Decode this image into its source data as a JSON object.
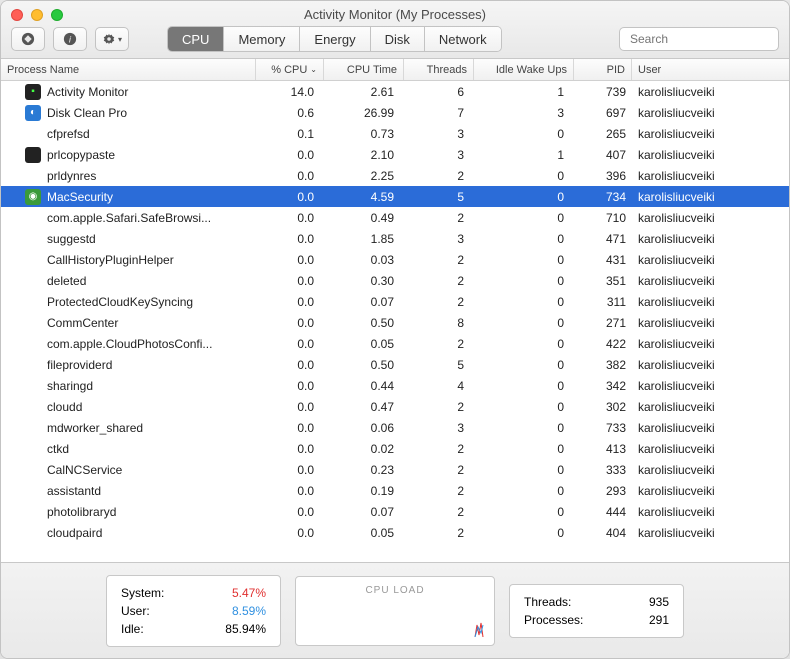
{
  "window_title": "Activity Monitor (My Processes)",
  "tabs": {
    "cpu": "CPU",
    "memory": "Memory",
    "energy": "Energy",
    "disk": "Disk",
    "network": "Network"
  },
  "search_placeholder": "Search",
  "columns": {
    "name": "Process Name",
    "cpu": "% CPU",
    "time": "CPU Time",
    "threads": "Threads",
    "wake": "Idle Wake Ups",
    "pid": "PID",
    "user": "User"
  },
  "processes": [
    {
      "name": "Activity Monitor",
      "cpu": "14.0",
      "time": "2.61",
      "threads": "6",
      "wake": "1",
      "pid": "739",
      "user": "karolisliucveiki",
      "icon": "am"
    },
    {
      "name": "Disk Clean Pro",
      "cpu": "0.6",
      "time": "26.99",
      "threads": "7",
      "wake": "3",
      "pid": "697",
      "user": "karolisliucveiki",
      "icon": "dc"
    },
    {
      "name": "cfprefsd",
      "cpu": "0.1",
      "time": "0.73",
      "threads": "3",
      "wake": "0",
      "pid": "265",
      "user": "karolisliucveiki"
    },
    {
      "name": "prlcopypaste",
      "cpu": "0.0",
      "time": "2.10",
      "threads": "3",
      "wake": "1",
      "pid": "407",
      "user": "karolisliucveiki",
      "icon": "term"
    },
    {
      "name": "prldynres",
      "cpu": "0.0",
      "time": "2.25",
      "threads": "2",
      "wake": "0",
      "pid": "396",
      "user": "karolisliucveiki"
    },
    {
      "name": "MacSecurity",
      "cpu": "0.0",
      "time": "4.59",
      "threads": "5",
      "wake": "0",
      "pid": "734",
      "user": "karolisliucveiki",
      "icon": "shield",
      "selected": true
    },
    {
      "name": "com.apple.Safari.SafeBrowsi...",
      "cpu": "0.0",
      "time": "0.49",
      "threads": "2",
      "wake": "0",
      "pid": "710",
      "user": "karolisliucveiki"
    },
    {
      "name": "suggestd",
      "cpu": "0.0",
      "time": "1.85",
      "threads": "3",
      "wake": "0",
      "pid": "471",
      "user": "karolisliucveiki"
    },
    {
      "name": "CallHistoryPluginHelper",
      "cpu": "0.0",
      "time": "0.03",
      "threads": "2",
      "wake": "0",
      "pid": "431",
      "user": "karolisliucveiki"
    },
    {
      "name": "deleted",
      "cpu": "0.0",
      "time": "0.30",
      "threads": "2",
      "wake": "0",
      "pid": "351",
      "user": "karolisliucveiki"
    },
    {
      "name": "ProtectedCloudKeySyncing",
      "cpu": "0.0",
      "time": "0.07",
      "threads": "2",
      "wake": "0",
      "pid": "311",
      "user": "karolisliucveiki"
    },
    {
      "name": "CommCenter",
      "cpu": "0.0",
      "time": "0.50",
      "threads": "8",
      "wake": "0",
      "pid": "271",
      "user": "karolisliucveiki"
    },
    {
      "name": "com.apple.CloudPhotosConfi...",
      "cpu": "0.0",
      "time": "0.05",
      "threads": "2",
      "wake": "0",
      "pid": "422",
      "user": "karolisliucveiki"
    },
    {
      "name": "fileproviderd",
      "cpu": "0.0",
      "time": "0.50",
      "threads": "5",
      "wake": "0",
      "pid": "382",
      "user": "karolisliucveiki"
    },
    {
      "name": "sharingd",
      "cpu": "0.0",
      "time": "0.44",
      "threads": "4",
      "wake": "0",
      "pid": "342",
      "user": "karolisliucveiki"
    },
    {
      "name": "cloudd",
      "cpu": "0.0",
      "time": "0.47",
      "threads": "2",
      "wake": "0",
      "pid": "302",
      "user": "karolisliucveiki"
    },
    {
      "name": "mdworker_shared",
      "cpu": "0.0",
      "time": "0.06",
      "threads": "3",
      "wake": "0",
      "pid": "733",
      "user": "karolisliucveiki"
    },
    {
      "name": "ctkd",
      "cpu": "0.0",
      "time": "0.02",
      "threads": "2",
      "wake": "0",
      "pid": "413",
      "user": "karolisliucveiki"
    },
    {
      "name": "CalNCService",
      "cpu": "0.0",
      "time": "0.23",
      "threads": "2",
      "wake": "0",
      "pid": "333",
      "user": "karolisliucveiki"
    },
    {
      "name": "assistantd",
      "cpu": "0.0",
      "time": "0.19",
      "threads": "2",
      "wake": "0",
      "pid": "293",
      "user": "karolisliucveiki"
    },
    {
      "name": "photolibraryd",
      "cpu": "0.0",
      "time": "0.07",
      "threads": "2",
      "wake": "0",
      "pid": "444",
      "user": "karolisliucveiki"
    },
    {
      "name": "cloudpaird",
      "cpu": "0.0",
      "time": "0.05",
      "threads": "2",
      "wake": "0",
      "pid": "404",
      "user": "karolisliucveiki"
    }
  ],
  "footer": {
    "system_label": "System:",
    "system_value": "5.47%",
    "user_label": "User:",
    "user_value": "8.59%",
    "idle_label": "Idle:",
    "idle_value": "85.94%",
    "load_label": "CPU LOAD",
    "threads_label": "Threads:",
    "threads_value": "935",
    "procs_label": "Processes:",
    "procs_value": "291"
  }
}
